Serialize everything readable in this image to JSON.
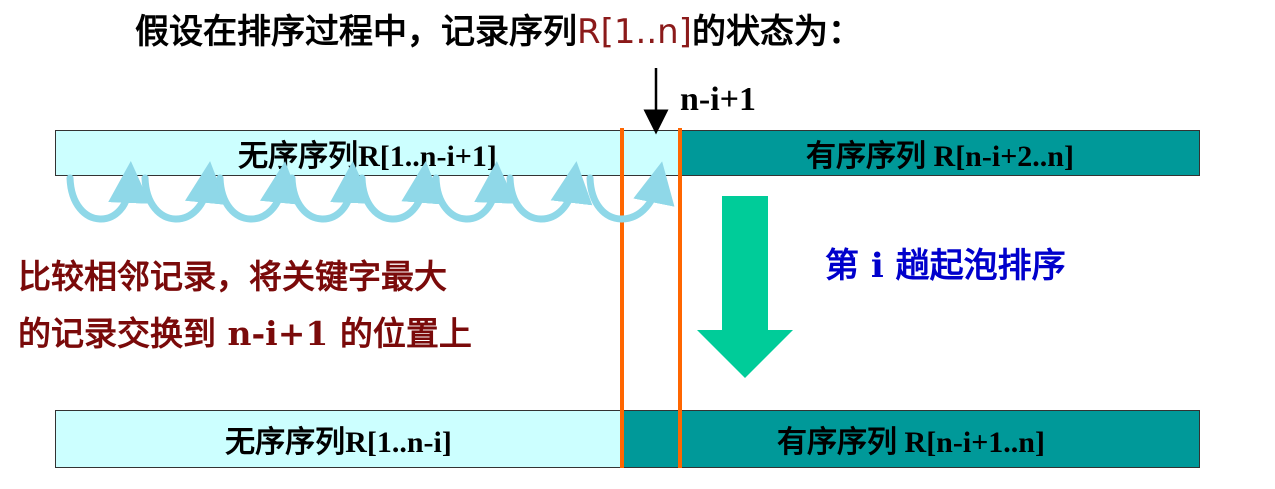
{
  "title": {
    "prefix": "假设在排序过程中，记录序列",
    "highlight": "R[1..n]",
    "suffix": "的状态为："
  },
  "pointer_label": "n-i+1",
  "top_row": {
    "unsorted": "无序序列R[1..n-i+1]",
    "sorted": "有序序列 R[n-i+2..n]"
  },
  "bottom_row": {
    "unsorted": "无序序列R[1..n-i]",
    "sorted": "有序序列 R[n-i+1..n]"
  },
  "description": {
    "line1": "比较相邻记录，将关键字最大",
    "line2": "的记录交换到 n-i+1 的位置上"
  },
  "pass_label": "第 i 趟起泡排序",
  "colors": {
    "light": "#ccffff",
    "teal": "#009999",
    "orange": "#ff6600",
    "red_text": "#7a0a0a",
    "blue_text": "#0000cc",
    "green_arrow": "#00cc99"
  }
}
